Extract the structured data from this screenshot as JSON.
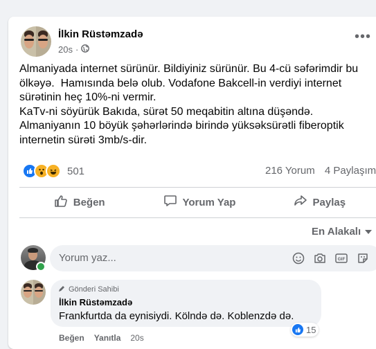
{
  "post": {
    "author": "İlkin Rüstəmzadə",
    "time": "20s",
    "privacy_icon": "globe-icon",
    "text_lines": [
      "Almaniyada internet sürünür. Bildiyiniz sürünür. Bu 4-cü səfərimdir bu ölkəyə.  Hamısında belə olub. Vodafone Bakcell-in verdiyi internet sürətinin heç 10%-ni vermir.",
      "KaTv-ni söyürük Bakıda, sürət 50 meqabitin altına düşəndə.",
      "Almaniyanın 10 böyük şəhərlərində birində yüksəksürətli fiberoptik internetin sürəti 3mb/s-dir."
    ],
    "reaction_count": "501",
    "comments_count": "216 Yorum",
    "shares_count": "4 Paylaşım"
  },
  "actions": {
    "like": "Beğen",
    "comment": "Yorum Yap",
    "share": "Paylaş"
  },
  "sort": {
    "label": "En Alakalı"
  },
  "composer": {
    "placeholder": "Yorum yaz..."
  },
  "comment": {
    "badge": "Gönderi Sahibi",
    "author": "İlkin Rüstəmzadə",
    "text": "Frankfurtda da eynisiydi. Kölndə də. Koblenzdə də.",
    "like_label": "Beğen",
    "reply_label": "Yanıtla",
    "time": "20s",
    "reaction_count": "15"
  },
  "colors": {
    "accent": "#1877f2",
    "secondary_text": "#65676b",
    "online": "#31a24c",
    "bubble": "#f0f2f5"
  }
}
